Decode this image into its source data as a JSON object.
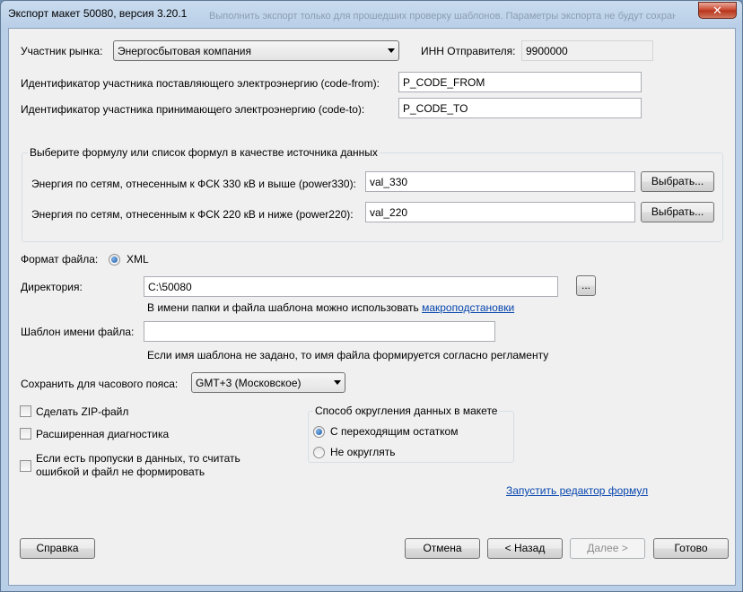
{
  "window": {
    "title": "Экспорт макет 50080, версия 3.20.1",
    "close_label": "✕",
    "ghost_text": "Выполнить экспорт только для прошедших проверку шаблонов. Параметры экспорта не будут сохранены"
  },
  "market": {
    "participant_label": "Участник рынка:",
    "participant_value": "Энергосбытовая компания",
    "inn_label": "ИНН Отправителя:",
    "inn_value": "9900000"
  },
  "codes": {
    "from_label": "Идентификатор участника поставляющего электроэнергию (code-from):",
    "from_value": "P_CODE_FROM",
    "to_label": "Идентификатор участника принимающего электроэнергию (code-to):",
    "to_value": "P_CODE_TO"
  },
  "formula_group": {
    "title": "Выберите формулу или список формул в качестве источника данных",
    "rows": [
      {
        "label": "Энергия по сетям, отнесенным к ФСК 330 кВ и выше (power330):",
        "value": "val_330",
        "button": "Выбрать..."
      },
      {
        "label": "Энергия по сетям, отнесенным к ФСК 220 кВ и ниже (power220):",
        "value": "val_220",
        "button": "Выбрать..."
      }
    ]
  },
  "file": {
    "format_label": "Формат файла:",
    "format_value": "XML",
    "dir_label": "Директория:",
    "dir_value": "C:\\50080",
    "browse_label": "...",
    "dir_hint": "В имени папки и файла шаблона можно использовать",
    "dir_hint_link": "макроподстановки",
    "template_label": "Шаблон имени файла:",
    "template_value": "",
    "template_hint": "Если имя шаблона не задано, то имя файла формируется согласно регламенту",
    "tz_label": "Сохранить для часового пояса:",
    "tz_value": "GMT+3 (Московское)"
  },
  "options": {
    "zip_label": "Сделать ZIP-файл",
    "diag_label": "Расширенная диагностика",
    "gaps_label_1": "Если есть пропуски в данных, то считать",
    "gaps_label_2": "ошибкой и файл не формировать"
  },
  "rounding": {
    "title": "Способ округления данных в макете",
    "opt1": "С переходящим остатком",
    "opt2": "Не округлять"
  },
  "formula_editor_link": "Запустить редактор формул",
  "footer": {
    "help": "Справка",
    "cancel": "Отмена",
    "back": "< Назад",
    "next": "Далее >",
    "done": "Готово"
  }
}
